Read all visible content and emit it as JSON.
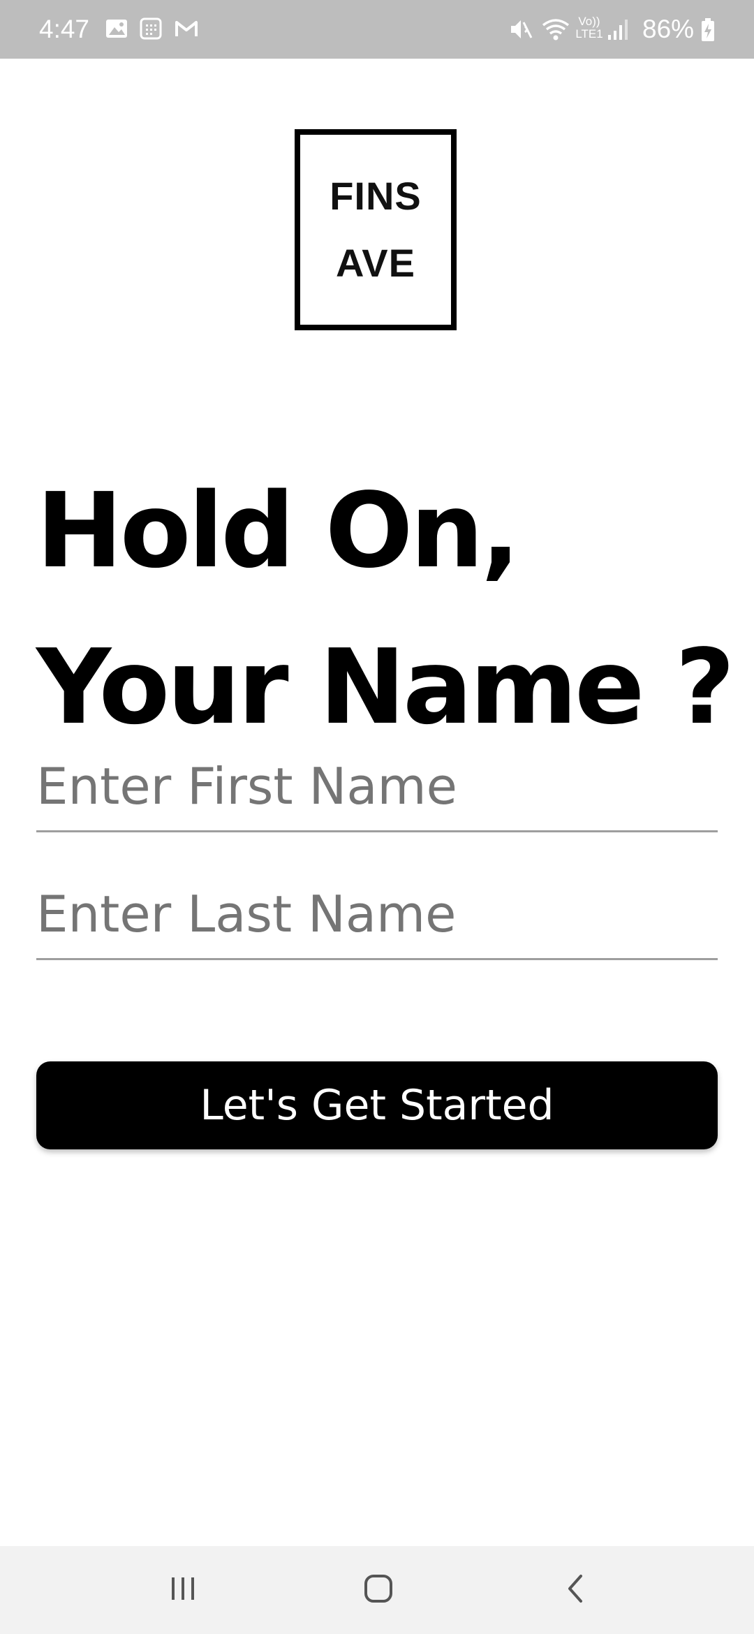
{
  "status_bar": {
    "time": "4:47",
    "battery_text": "86%",
    "left_icons": [
      "gallery-icon",
      "calendar-icon",
      "gmail-icon"
    ],
    "right_icons": [
      "mute-icon",
      "wifi-icon",
      "volte-icon",
      "signal-icon",
      "battery-charging-icon"
    ],
    "volte_label_top": "Vo))",
    "volte_label_bottom": "LTE1"
  },
  "logo": {
    "line1": "FINS",
    "line2": "AVE"
  },
  "heading": {
    "line1": "Hold On,",
    "line2": "Your Name ?"
  },
  "form": {
    "first_name": {
      "value": "",
      "placeholder": "Enter First Name"
    },
    "last_name": {
      "value": "",
      "placeholder": "Enter Last Name"
    },
    "submit_label": "Let's Get Started"
  },
  "nav_bar": {
    "buttons": [
      "recent-apps-icon",
      "home-icon",
      "back-icon"
    ]
  },
  "colors": {
    "status_bar_bg": "#bdbdbd",
    "primary": "#000000",
    "placeholder": "#757575",
    "divider": "#9e9e9e",
    "nav_bar_bg": "#f2f2f2"
  }
}
